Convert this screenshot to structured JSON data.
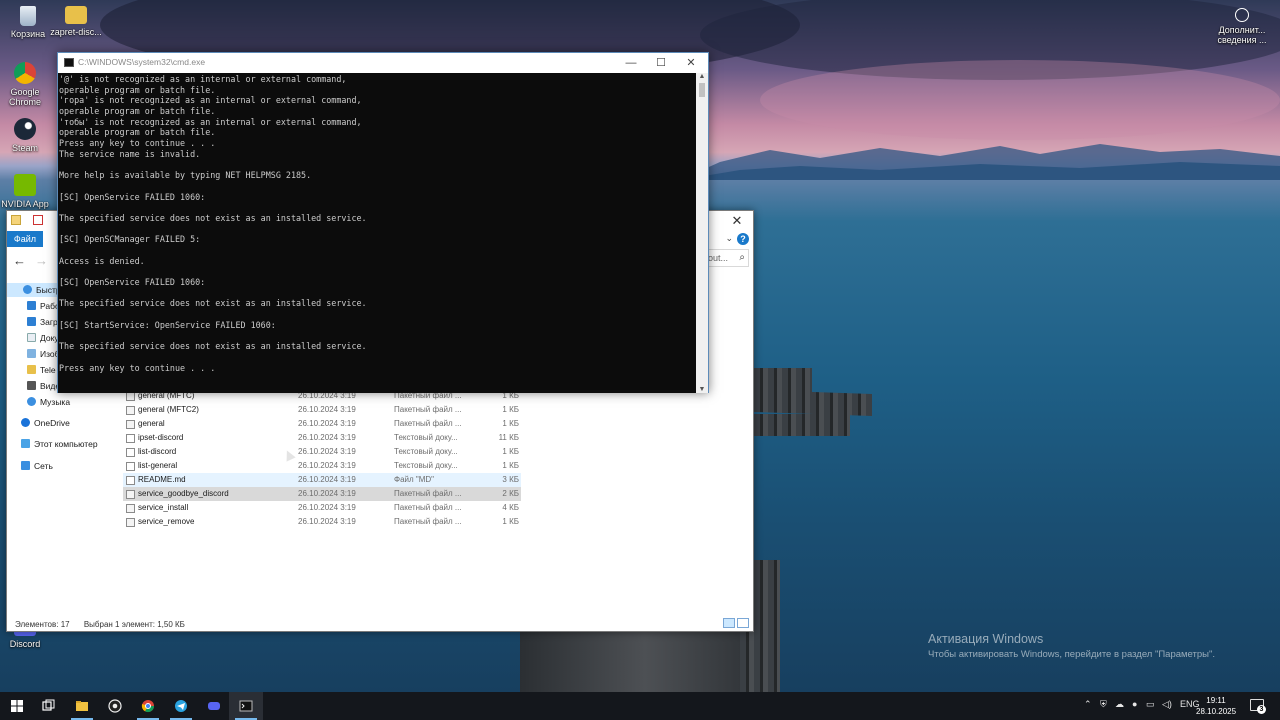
{
  "desktop": {
    "icons": [
      {
        "label": "Корзина",
        "icon": "recycle-bin-icon"
      },
      {
        "label": "zapret-disc...",
        "icon": "folder-icon"
      },
      {
        "label": "Google Chrome",
        "icon": "chrome-icon"
      },
      {
        "label": "Steam",
        "icon": "steam-icon"
      },
      {
        "label": "NVIDIA App",
        "icon": "nvidia-icon"
      },
      {
        "label": "Discord",
        "icon": "discord-icon"
      },
      {
        "label": "Дополнит... сведения ...",
        "icon": "info-icon"
      }
    ],
    "watermark": {
      "title": "Активация Windows",
      "subtitle": "Чтобы активировать Windows, перейдите в раздел \"Параметры\"."
    }
  },
  "cmd": {
    "title": "C:\\WINDOWS\\system32\\cmd.exe",
    "lines": [
      "'@' is not recognized as an internal or external command,",
      "operable program or batch file.",
      "'гора' is not recognized as an internal or external command,",
      "operable program or batch file.",
      "'тобы' is not recognized as an internal or external command,",
      "operable program or batch file.",
      "Press any key to continue . . .",
      "The service name is invalid.",
      "",
      "More help is available by typing NET HELPMSG 2185.",
      "",
      "[SC] OpenService FAILED 1060:",
      "",
      "The specified service does not exist as an installed service.",
      "",
      "[SC] OpenSCManager FAILED 5:",
      "",
      "Access is denied.",
      "",
      "[SC] OpenService FAILED 1060:",
      "",
      "The specified service does not exist as an installed service.",
      "",
      "[SC] StartService: OpenService FAILED 1060:",
      "",
      "The specified service does not exist as an installed service.",
      "",
      "Press any key to continue . . ."
    ]
  },
  "explorer": {
    "ribbon_tab": "Файл",
    "search_placeholder": "out...",
    "nav": [
      {
        "label": "Быстр",
        "selected": true
      },
      {
        "label": "Рабо"
      },
      {
        "label": "Загр"
      },
      {
        "label": "Доку"
      },
      {
        "label": "Изоб"
      },
      {
        "label": "Tele"
      },
      {
        "label": "Виде"
      },
      {
        "label": "Музыка"
      },
      {
        "label": "OneDrive"
      },
      {
        "label": "Этот компьютер"
      },
      {
        "label": "Сеть"
      }
    ],
    "files": [
      {
        "name": "general (MFTC)",
        "date": "26.10.2024 3:19",
        "type": "Пакетный файл ...",
        "size": "1 КБ"
      },
      {
        "name": "general (MFTC2)",
        "date": "26.10.2024 3:19",
        "type": "Пакетный файл ...",
        "size": "1 КБ"
      },
      {
        "name": "general",
        "date": "26.10.2024 3:19",
        "type": "Пакетный файл ...",
        "size": "1 КБ"
      },
      {
        "name": "ipset-discord",
        "date": "26.10.2024 3:19",
        "type": "Текстовый доку...",
        "size": "11 КБ"
      },
      {
        "name": "list-discord",
        "date": "26.10.2024 3:19",
        "type": "Текстовый доку...",
        "size": "1 КБ"
      },
      {
        "name": "list-general",
        "date": "26.10.2024 3:19",
        "type": "Текстовый доку...",
        "size": "1 КБ"
      },
      {
        "name": "README.md",
        "date": "26.10.2024 3:19",
        "type": "Файл \"MD\"",
        "size": "3 КБ",
        "state": "hover"
      },
      {
        "name": "service_goodbye_discord",
        "date": "26.10.2024 3:19",
        "type": "Пакетный файл ...",
        "size": "2 КБ",
        "state": "selected"
      },
      {
        "name": "service_install",
        "date": "26.10.2024 3:19",
        "type": "Пакетный файл ...",
        "size": "4 КБ"
      },
      {
        "name": "service_remove",
        "date": "26.10.2024 3:19",
        "type": "Пакетный файл ...",
        "size": "1 КБ"
      }
    ],
    "status": {
      "count": "Элементов: 17",
      "selection": "Выбран 1 элемент: 1,50 КБ"
    }
  },
  "taskbar": {
    "language": "ENG",
    "time": "19:11",
    "date": "28.10.2025",
    "notifications": "3",
    "apps": [
      "start-icon",
      "task-view-icon",
      "file-explorer-icon",
      "obs-icon",
      "chrome-icon",
      "telegram-icon",
      "discord-icon",
      "cmd-icon"
    ]
  },
  "colors": {
    "accent": "#1979ca",
    "console_bg": "#0c0c0c",
    "console_fg": "#cccccc"
  }
}
